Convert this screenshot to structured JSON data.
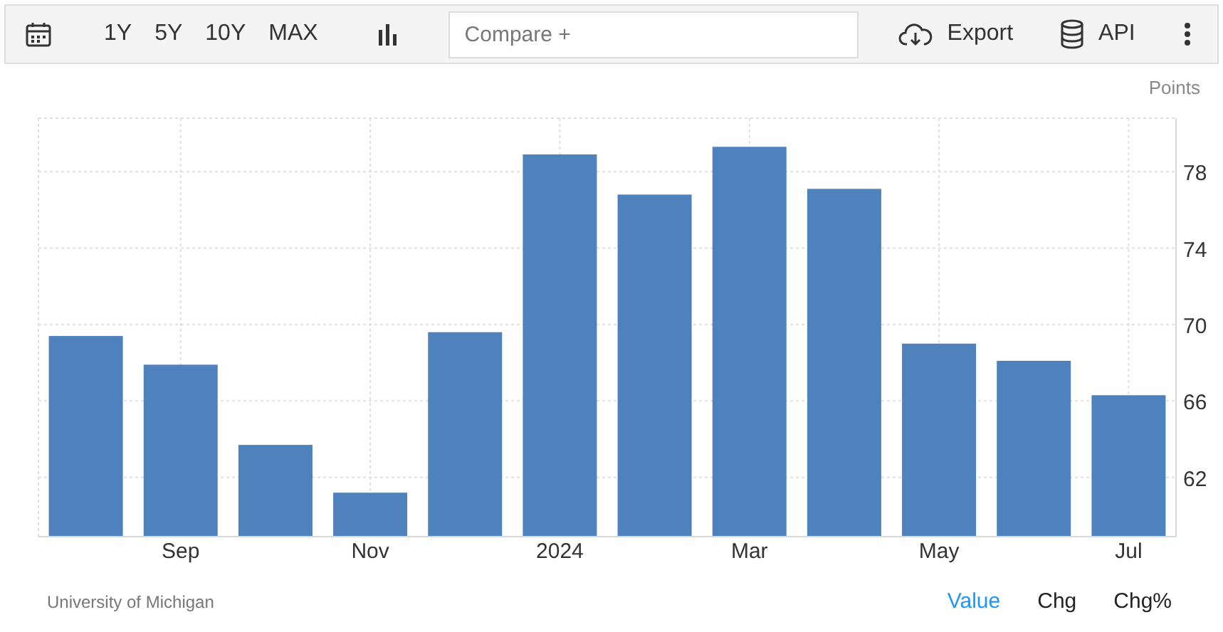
{
  "toolbar": {
    "ranges": [
      {
        "label": "1Y"
      },
      {
        "label": "5Y"
      },
      {
        "label": "10Y"
      },
      {
        "label": "MAX"
      }
    ],
    "compare": {
      "placeholder": "Compare +"
    },
    "actions": [
      {
        "kind": "export",
        "label": "Export"
      },
      {
        "kind": "api",
        "label": "API"
      }
    ]
  },
  "chart": {
    "chart_data": {
      "type": "bar",
      "ylabel": "Points",
      "categories": [
        null,
        "Sep",
        null,
        "Nov",
        null,
        "2024",
        null,
        "Mar",
        null,
        "May",
        null,
        "Jul"
      ],
      "series": [
        {
          "color": "#4f81bd",
          "values": [
            69.4,
            67.9,
            63.7,
            61.2,
            69.6,
            78.9,
            76.8,
            79.3,
            77.1,
            69.0,
            68.1,
            66.3
          ]
        }
      ],
      "ylim": [
        58.9,
        80.8
      ],
      "grid": true,
      "yticks": [
        62,
        66,
        70,
        74,
        78
      ]
    }
  },
  "footer": {
    "source": "University of Michigan",
    "modes": [
      {
        "label": "Value",
        "selected": true
      },
      {
        "label": "Chg",
        "selected": false
      },
      {
        "label": "Chg%",
        "selected": false
      }
    ]
  }
}
